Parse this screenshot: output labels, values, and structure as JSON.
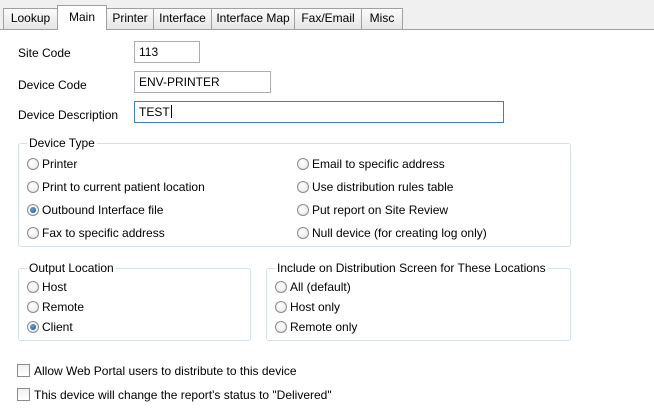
{
  "tabs": [
    {
      "label": "Lookup"
    },
    {
      "label": "Main"
    },
    {
      "label": "Printer"
    },
    {
      "label": "Interface"
    },
    {
      "label": "Interface Map"
    },
    {
      "label": "Fax/Email"
    },
    {
      "label": "Misc"
    }
  ],
  "active_tab": "Main",
  "form": {
    "site_code_label": "Site Code",
    "site_code_value": "113",
    "device_code_label": "Device Code",
    "device_code_value": "ENV-PRINTER",
    "device_description_label": "Device Description",
    "device_description_value": "TEST"
  },
  "device_type": {
    "title": "Device Type",
    "options": [
      {
        "label": "Printer",
        "checked": false
      },
      {
        "label": "Print to current patient location",
        "checked": false
      },
      {
        "label": "Outbound Interface file",
        "checked": true
      },
      {
        "label": "Fax to specific address",
        "checked": false
      },
      {
        "label": "Email to specific address",
        "checked": false
      },
      {
        "label": "Use distribution rules table",
        "checked": false
      },
      {
        "label": "Put report on Site Review",
        "checked": false
      },
      {
        "label": "Null device (for creating log only)",
        "checked": false
      }
    ]
  },
  "output_location": {
    "title": "Output Location",
    "options": [
      {
        "label": "Host",
        "checked": false
      },
      {
        "label": "Remote",
        "checked": false
      },
      {
        "label": "Client",
        "checked": true
      }
    ]
  },
  "distribution_screen": {
    "title": "Include on Distribution Screen for These Locations",
    "options": [
      {
        "label": "All (default)",
        "checked": false
      },
      {
        "label": "Host only",
        "checked": false
      },
      {
        "label": "Remote only",
        "checked": false
      }
    ]
  },
  "checkboxes": [
    {
      "label": "Allow Web Portal users to distribute to this device",
      "checked": false
    },
    {
      "label": "This device will change the report's status to \"Delivered\"",
      "checked": false
    }
  ]
}
